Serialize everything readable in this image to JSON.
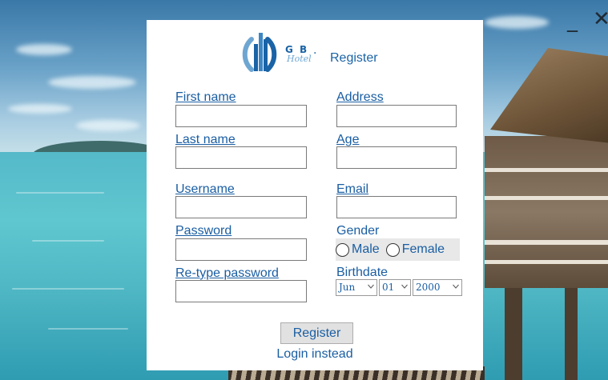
{
  "window": {
    "minimize_glyph": "_",
    "close_glyph": "✕"
  },
  "brand": {
    "logo_name": "gb-hotel-logo",
    "logo_gb": "G B",
    "logo_hotel": "Hotel",
    "separator": "·",
    "title": "Register"
  },
  "form": {
    "first_name": {
      "label": "First name",
      "value": ""
    },
    "last_name": {
      "label": "Last name",
      "value": ""
    },
    "username": {
      "label": "Username",
      "value": ""
    },
    "password": {
      "label": "Password",
      "value": ""
    },
    "retype_password": {
      "label": "Re-type password",
      "value": ""
    },
    "address": {
      "label": "Address",
      "value": ""
    },
    "age": {
      "label": "Age",
      "value": ""
    },
    "email": {
      "label": "Email",
      "value": ""
    },
    "gender": {
      "label": "Gender",
      "options": [
        "Male",
        "Female"
      ],
      "selected": null
    },
    "birthdate": {
      "label": "Birthdate",
      "month": "Jun",
      "day": "01",
      "year": "2000"
    }
  },
  "actions": {
    "register_label": "Register",
    "login_label": "Login instead"
  },
  "colors": {
    "accent": "#1a5ea3",
    "panel": "#ffffff",
    "button": "#e1e1e1"
  }
}
